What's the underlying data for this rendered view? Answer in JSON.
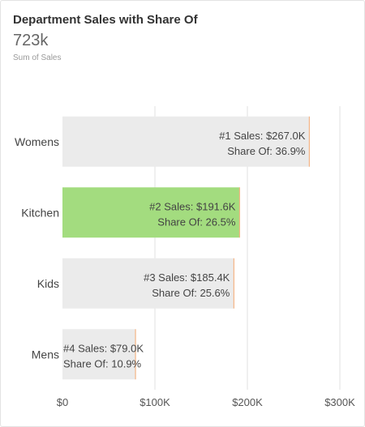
{
  "header": {
    "title": "Department Sales with Share Of",
    "total": "723k",
    "total_label": "Sum of Sales"
  },
  "colors": {
    "bar_default": "#ebebeb",
    "bar_highlight": "#a3dc7f",
    "bar_edge": "#f5b586",
    "grid": "#e2e2e2"
  },
  "chart_data": {
    "type": "bar",
    "orientation": "horizontal",
    "categories": [
      "Womens",
      "Kitchen",
      "Kids",
      "Mens"
    ],
    "values": [
      267.0,
      191.6,
      185.4,
      79.0
    ],
    "share_percent": [
      36.9,
      26.5,
      25.6,
      10.9
    ],
    "highlighted_category": "Kitchen",
    "bar_labels": [
      [
        "#1 Sales: $267.0K",
        "Share Of: 36.9%"
      ],
      [
        "#2 Sales: $191.6K",
        "Share Of: 26.5%"
      ],
      [
        "#3 Sales: $185.4K",
        "Share Of: 25.6%"
      ],
      [
        "#4 Sales: $79.0K",
        "Share Of: 10.9%"
      ]
    ],
    "xlim": [
      0,
      300
    ],
    "xticks": [
      0,
      100,
      200,
      300
    ],
    "xtick_labels": [
      "$0",
      "$100K",
      "$200K",
      "$300K"
    ],
    "xlabel": "",
    "ylabel": "",
    "grid": true
  }
}
